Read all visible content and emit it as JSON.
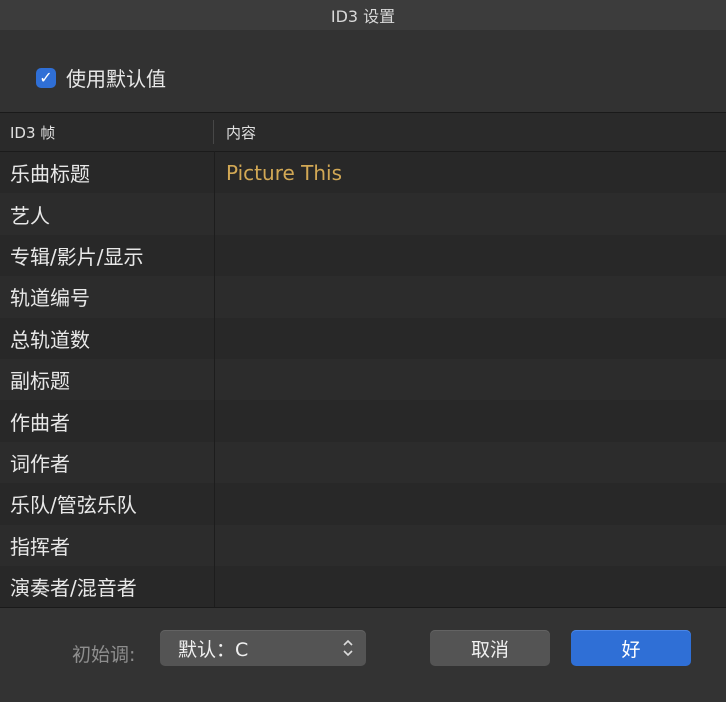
{
  "window": {
    "title": "ID3 设置"
  },
  "options": {
    "use_defaults_label": "使用默认值",
    "use_defaults_checked": true
  },
  "table": {
    "headers": {
      "frame": "ID3 帧",
      "content": "内容"
    },
    "rows": [
      {
        "frame": "乐曲标题",
        "content": "Picture This"
      },
      {
        "frame": "艺人",
        "content": ""
      },
      {
        "frame": "专辑/影片/显示",
        "content": ""
      },
      {
        "frame": "轨道编号",
        "content": ""
      },
      {
        "frame": "总轨道数",
        "content": ""
      },
      {
        "frame": "副标题",
        "content": ""
      },
      {
        "frame": "作曲者",
        "content": ""
      },
      {
        "frame": "词作者",
        "content": ""
      },
      {
        "frame": "乐队/管弦乐队",
        "content": ""
      },
      {
        "frame": "指挥者",
        "content": ""
      },
      {
        "frame": "演奏者/混音者",
        "content": ""
      }
    ]
  },
  "footer": {
    "key_label": "初始调:",
    "key_value": "默认：C",
    "cancel_label": "取消",
    "ok_label": "好"
  },
  "colors": {
    "accent": "#2f6fd6",
    "content_text": "#d2a855"
  }
}
